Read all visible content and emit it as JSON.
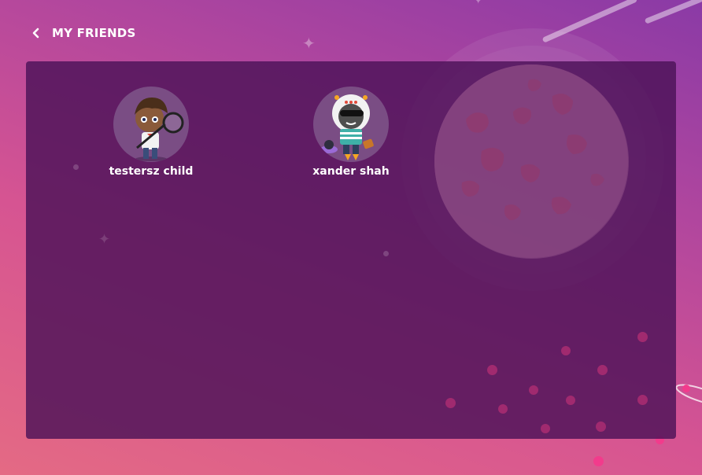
{
  "header": {
    "title": "MY FRIENDS",
    "back_icon": "chevron-left-icon"
  },
  "friends": [
    {
      "name": "testersz child",
      "avatar_icon": "explorer-avatar-icon"
    },
    {
      "name": "xander shah",
      "avatar_icon": "astronaut-avatar-icon"
    }
  ],
  "colors": {
    "panel": "#4c1258",
    "accent_pink": "#f23b8c",
    "text": "#ffffff"
  }
}
